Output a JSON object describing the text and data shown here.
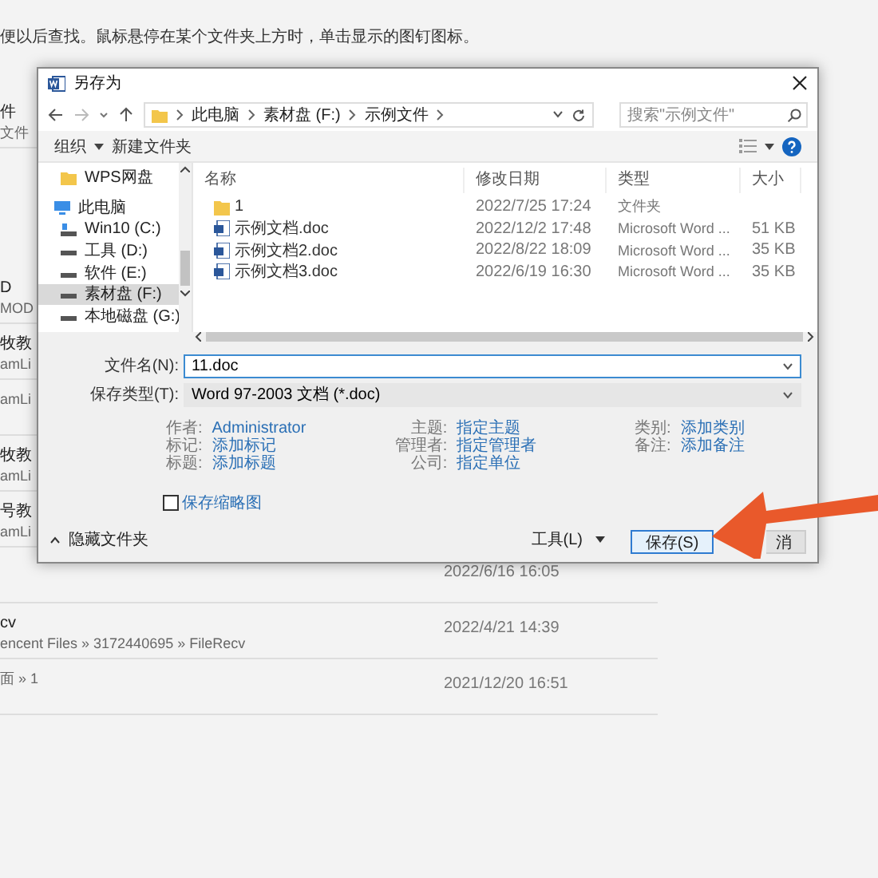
{
  "background": {
    "hint": "便以后查找。鼠标悬停在某个文件夹上方时，单击显示的图钉图标。",
    "rows": [
      {
        "title": "件",
        "path": "文件"
      },
      {
        "title": "D",
        "path": "MOD"
      },
      {
        "title": "牧教",
        "path": "amLi"
      },
      {
        "path": "amLi"
      },
      {
        "title": "牧教",
        "path": "amLi"
      },
      {
        "title": "号教",
        "path": "amLi"
      },
      {
        "date": "2022/6/16 16:05"
      },
      {
        "title": "cv",
        "path": "encent Files » 3172440695 » FileRecv",
        "date": "2022/4/21 14:39"
      },
      {
        "path": "面 » 1",
        "date": "2021/12/20 16:51"
      }
    ]
  },
  "dialog": {
    "title": "另存为",
    "breadcrumb": [
      "此电脑",
      "素材盘 (F:)",
      "示例文件"
    ],
    "search": {
      "placeholder": "搜索\"示例文件\""
    },
    "toolbar": [
      "组织",
      "新建文件夹"
    ],
    "nav": [
      {
        "label": "WPS网盘",
        "kind": "cloud",
        "selected": false
      },
      {
        "label": "此电脑",
        "kind": "pc",
        "selected": false
      },
      {
        "label": "Win10 (C:)",
        "kind": "system-drive",
        "selected": false
      },
      {
        "label": "工具 (D:)",
        "kind": "drive",
        "selected": false
      },
      {
        "label": "软件 (E:)",
        "kind": "drive",
        "selected": false
      },
      {
        "label": "素材盘 (F:)",
        "kind": "drive",
        "selected": true
      },
      {
        "label": "本地磁盘 (G:)",
        "kind": "drive",
        "selected": false
      }
    ],
    "columns": [
      "名称",
      "修改日期",
      "类型",
      "大小"
    ],
    "files": [
      {
        "kind": "folder",
        "name": "1",
        "date": "2022/7/25 17:24",
        "type": "文件夹"
      },
      {
        "kind": "doc",
        "name": "示例文档.doc",
        "date": "2022/12/2 17:48",
        "type": "Microsoft Word ...",
        "size": "51 KB"
      },
      {
        "kind": "doc",
        "name": "示例文档2.doc",
        "date": "2022/8/22 18:09",
        "type": "Microsoft Word ...",
        "size": "35 KB"
      },
      {
        "kind": "doc",
        "name": "示例文档3.doc",
        "date": "2022/6/19 16:30",
        "type": "Microsoft Word ...",
        "size": "35 KB"
      }
    ],
    "filename": {
      "label": "文件名(N):",
      "value": "11.doc"
    },
    "savetype": {
      "label": "保存类型(T):",
      "value": "Word 97-2003 文档 (*.doc)"
    },
    "meta": [
      [
        {
          "label": "作者:",
          "value": "Administrator"
        },
        {
          "label": "标记:",
          "value": "添加标记"
        },
        {
          "label": "标题:",
          "value": "添加标题"
        }
      ],
      [
        {
          "label": "主题:",
          "value": "指定主题"
        },
        {
          "label": "管理者:",
          "value": "指定管理者"
        },
        {
          "label": "公司:",
          "value": "指定单位"
        }
      ],
      [
        {
          "label": "类别:",
          "value": "添加类别"
        },
        {
          "label": "备注:",
          "value": "添加备注"
        }
      ]
    ],
    "thumbnail": {
      "label": "保存缩略图",
      "checked": false
    },
    "hide_folders": "隐藏文件夹",
    "tools": "工具(L)",
    "buttons": [
      {
        "label": "保存(S)",
        "kind": "default"
      },
      {
        "label": "消",
        "kind": "normal"
      }
    ]
  }
}
